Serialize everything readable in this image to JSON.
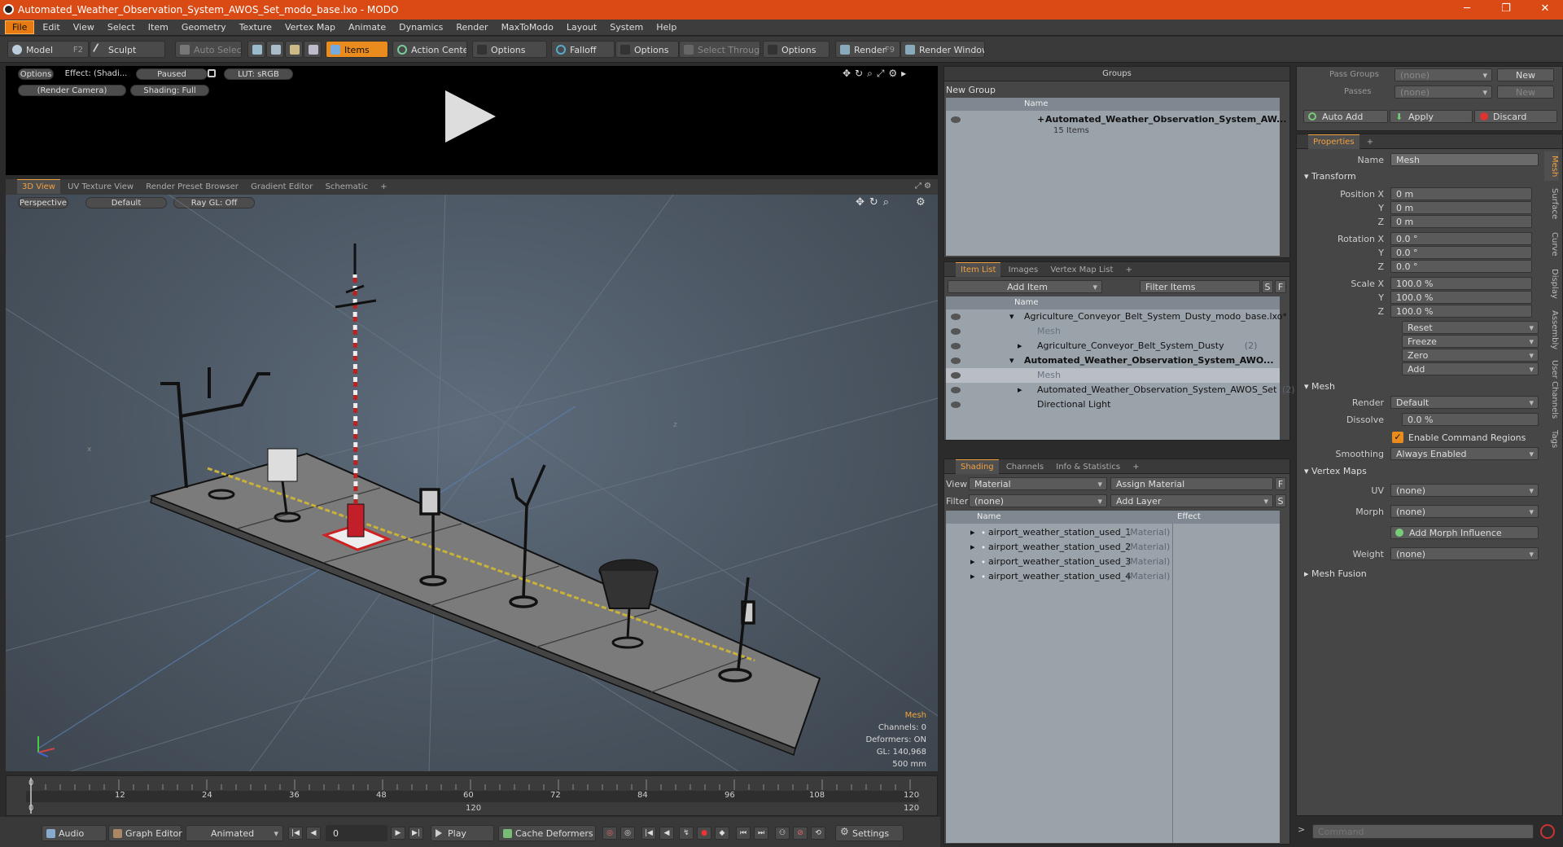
{
  "window": {
    "title": "Automated_Weather_Observation_System_AWOS_Set_modo_base.lxo - MODO"
  },
  "menu": [
    "File",
    "Edit",
    "View",
    "Select",
    "Item",
    "Geometry",
    "Texture",
    "Vertex Map",
    "Animate",
    "Dynamics",
    "Render",
    "MaxToModo",
    "Layout",
    "System",
    "Help"
  ],
  "toolbar": {
    "model": "Model",
    "model_key": "F2",
    "sculpt": "Sculpt",
    "auto_select": "Auto Select",
    "items": "Items",
    "action_center": "Action Center",
    "options1": "Options",
    "falloff": "Falloff",
    "options2": "Options",
    "select_through": "Select Through",
    "options3": "Options",
    "render": "Render",
    "render_key": "F9",
    "render_window": "Render Window"
  },
  "render_preview": {
    "options": "Options",
    "effect": "Effect: (Shadi...",
    "paused": "Paused",
    "lut": "LUT: sRGB",
    "camera": "(Render Camera)",
    "shading": "Shading: Full"
  },
  "viewport_tabs": [
    "3D View",
    "UV Texture View",
    "Render Preset Browser",
    "Gradient Editor",
    "Schematic"
  ],
  "viewport": {
    "perspective": "Perspective",
    "default": "Default",
    "raygl": "Ray GL: Off",
    "info": {
      "mesh": "Mesh",
      "channels": "Channels: 0",
      "deformers": "Deformers: ON",
      "gl": "GL: 140,968",
      "scale": "500 mm"
    }
  },
  "timeline": {
    "ticks": [
      "0",
      "12",
      "24",
      "36",
      "48",
      "60",
      "72",
      "84",
      "96",
      "108",
      "120"
    ],
    "marks": [
      "0",
      "120",
      "120"
    ]
  },
  "bottom": {
    "audio": "Audio",
    "graph_editor": "Graph Editor",
    "animated": "Animated",
    "frame": "0",
    "play": "Play",
    "cache": "Cache Deformers",
    "settings": "Settings"
  },
  "groups": {
    "title": "Groups",
    "new_group": "New Group",
    "name_col": "Name",
    "item": {
      "name": "Automated_Weather_Observation_System_AW...",
      "count": "15 Items"
    }
  },
  "item_list": {
    "tabs": [
      "Item List",
      "Images",
      "Vertex Map List"
    ],
    "add_item": "Add Item",
    "filter": "Filter Items",
    "s": "S",
    "f": "F",
    "name_col": "Name",
    "rows": [
      {
        "label": "Agriculture_Conveyor_Belt_System_Dusty_modo_base.lxo*",
        "indent": 0,
        "expander": "▾",
        "bold": false,
        "muted": false,
        "suffix": ""
      },
      {
        "label": "Mesh",
        "indent": 1,
        "expander": "",
        "bold": false,
        "muted": true,
        "suffix": ""
      },
      {
        "label": "Agriculture_Conveyor_Belt_System_Dusty",
        "indent": 1,
        "expander": "▸",
        "bold": false,
        "muted": false,
        "suffix": "(2)"
      },
      {
        "label": "Automated_Weather_Observation_System_AWO...",
        "indent": 0,
        "expander": "▾",
        "bold": true,
        "muted": false,
        "suffix": ""
      },
      {
        "label": "Mesh",
        "indent": 1,
        "expander": "",
        "bold": false,
        "muted": true,
        "suffix": ""
      },
      {
        "label": "Automated_Weather_Observation_System_AWOS_Set",
        "indent": 1,
        "expander": "▸",
        "bold": false,
        "muted": false,
        "suffix": "(2)"
      },
      {
        "label": "Directional Light",
        "indent": 1,
        "expander": "",
        "bold": false,
        "muted": false,
        "suffix": ""
      }
    ]
  },
  "shading": {
    "tabs": [
      "Shading",
      "Channels",
      "Info & Statistics"
    ],
    "view_label": "View",
    "view_value": "Material",
    "assign": "Assign Material",
    "f": "F",
    "filter_label": "Filter",
    "filter_value": "(none)",
    "add_layer": "Add Layer",
    "s": "S",
    "name_col": "Name",
    "effect_col": "Effect",
    "rows": [
      {
        "name": "airport_weather_station_used_1",
        "type": "(Material)"
      },
      {
        "name": "airport_weather_station_used_2",
        "type": "(Material)"
      },
      {
        "name": "airport_weather_station_used_3",
        "type": "(Material)"
      },
      {
        "name": "airport_weather_station_used_4",
        "type": "(Material)"
      }
    ]
  },
  "passes": {
    "pass_groups": "Pass Groups",
    "passes": "Passes",
    "none": "(none)",
    "new": "New",
    "auto_add": "Auto Add",
    "apply": "Apply",
    "discard": "Discard"
  },
  "properties": {
    "tab": "Properties",
    "name_label": "Name",
    "name_value": "Mesh",
    "transform": "Transform",
    "position_label": "Position X",
    "rotation_label": "Rotation X",
    "scale_label": "Scale X",
    "y": "Y",
    "z": "Z",
    "pos": [
      "0 m",
      "0 m",
      "0 m"
    ],
    "rot": [
      "0.0 °",
      "0.0 °",
      "0.0 °"
    ],
    "scl": [
      "100.0 %",
      "100.0 %",
      "100.0 %"
    ],
    "reset": "Reset",
    "freeze": "Freeze",
    "zero": "Zero",
    "add": "Add",
    "mesh": "Mesh",
    "render_label": "Render",
    "render_value": "Default",
    "dissolve_label": "Dissolve",
    "dissolve_value": "0.0 %",
    "cmd_regions": "Enable Command Regions",
    "smoothing_label": "Smoothing",
    "smoothing_value": "Always Enabled",
    "vertex_maps": "Vertex Maps",
    "uv_label": "UV",
    "uv_value": "(none)",
    "morph_label": "Morph",
    "morph_value": "(none)",
    "add_morph": "Add Morph Influence",
    "weight_label": "Weight",
    "weight_value": "(none)",
    "mesh_fusion": "Mesh Fusion",
    "side_tabs": [
      "Mesh",
      "Surface",
      "Curve",
      "Display",
      "Assembly",
      "User Channels",
      "Tags"
    ]
  },
  "command": {
    "placeholder": "Command"
  }
}
